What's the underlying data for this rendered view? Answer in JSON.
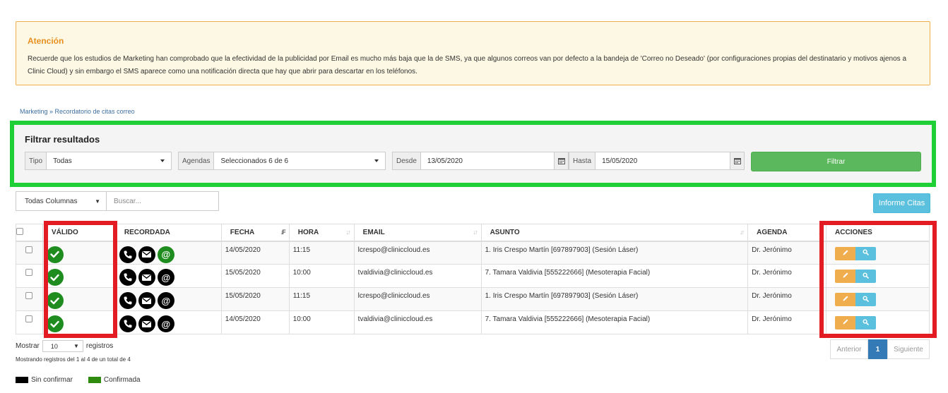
{
  "alert": {
    "title": "Atención",
    "text": "Recuerde que los estudios de Marketing han comprobado que la efectividad de la publicidad por Email es mucho más baja que la de SMS, ya que algunos correos van por defecto a la bandeja de 'Correo no Deseado' (por configuraciones propias del destinatario y motivos ajenos a Clinic Cloud) y sin embargo el SMS aparece como una notificación directa que hay que abrir para descartar en los teléfonos."
  },
  "breadcrumb": "Marketing » Recordatorio de citas correo",
  "filter": {
    "title": "Filtrar resultados",
    "tipo_label": "Tipo",
    "tipo_value": "Todas",
    "agendas_label": "Agendas",
    "agendas_value": "Seleccionados 6 de 6",
    "desde_label": "Desde",
    "desde_value": "13/05/2020",
    "hasta_label": "Hasta",
    "hasta_value": "15/05/2020",
    "button": "Filtrar"
  },
  "column_select": "Todas Columnas",
  "search_placeholder": "Buscar...",
  "report_button": "Informe Citas",
  "table": {
    "headers": [
      "VÁLIDO",
      "RECORDADA",
      "FECHA",
      "HORA",
      "EMAIL",
      "ASUNTO",
      "AGENDA",
      "ACCIONES"
    ],
    "rows": [
      {
        "fecha": "14/05/2020",
        "hora": "11:15",
        "email": "lcrespo@cliniccloud.es",
        "asunto": "1. Iris Crespo Martín [697897903] (Sesión Láser)",
        "agenda": "Dr. Jerónimo",
        "email_confirmed": true
      },
      {
        "fecha": "15/05/2020",
        "hora": "10:00",
        "email": "tvaldivia@cliniccloud.es",
        "asunto": "7. Tamara Valdivia [555222666] (Mesoterapia Facial)",
        "agenda": "Dr. Jerónimo",
        "email_confirmed": false
      },
      {
        "fecha": "15/05/2020",
        "hora": "11:15",
        "email": "lcrespo@cliniccloud.es",
        "asunto": "1. Iris Crespo Martín [697897903] (Sesión Láser)",
        "agenda": "Dr. Jerónimo",
        "email_confirmed": false
      },
      {
        "fecha": "14/05/2020",
        "hora": "10:00",
        "email": "tvaldivia@cliniccloud.es",
        "asunto": "7. Tamara Valdivia [555222666] (Mesoterapia Facial)",
        "agenda": "Dr. Jerónimo",
        "email_confirmed": false
      }
    ]
  },
  "length": {
    "prefix": "Mostrar",
    "value": "10",
    "suffix": "registros"
  },
  "info": "Mostrando registros del 1 al 4 de un total de 4",
  "pager": {
    "prev": "Anterior",
    "current": "1",
    "next": "Siguiente"
  },
  "legend": [
    {
      "label": "Sin confirmar",
      "color": "#000000"
    },
    {
      "label": "Confirmada",
      "color": "#2e8b0e"
    }
  ],
  "colors": {
    "highlight_green": "#1ed036",
    "highlight_red": "#e31b23",
    "valid_green": "#1e8c1e"
  }
}
